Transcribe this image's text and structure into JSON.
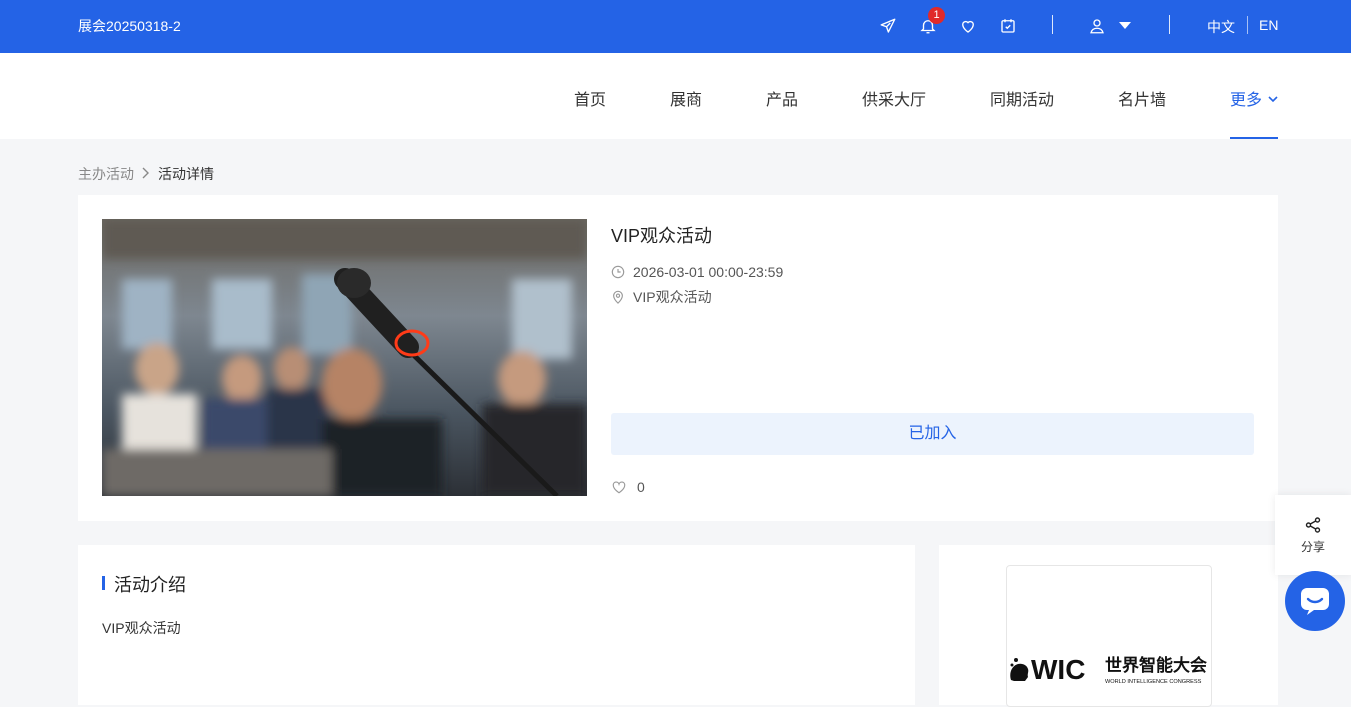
{
  "topbar": {
    "title": "展会20250318-2",
    "notification_count": "1",
    "lang_zh": "中文",
    "lang_en": "EN",
    "icons": [
      "send-icon",
      "bell-icon",
      "heart-icon",
      "calendar-check-icon",
      "user-icon",
      "caret-down-icon"
    ],
    "bg_color": "#2463e6"
  },
  "nav": {
    "items": [
      "首页",
      "展商",
      "产品",
      "供采大厅",
      "同期活动",
      "名片墙",
      "更多"
    ],
    "active": "更多"
  },
  "breadcrumb": {
    "parent": "主办活动",
    "current": "活动详情"
  },
  "event": {
    "title": "VIP观众活动",
    "datetime": "2026-03-01 00:00-23:59",
    "location": "VIP观众活动",
    "join_label": "已加入",
    "likes": "0"
  },
  "intro": {
    "heading": "活动介绍",
    "body": "VIP观众活动"
  },
  "organizer_logo": {
    "brand": "WIC",
    "name_cn": "世界智能大会",
    "name_en": "WORLD INTELLIGENCE CONGRESS"
  },
  "float": {
    "share_label": "分享"
  },
  "colors": {
    "accent": "#2463e6",
    "badge": "#e02a2a",
    "join_bg": "#ecf3fd"
  }
}
